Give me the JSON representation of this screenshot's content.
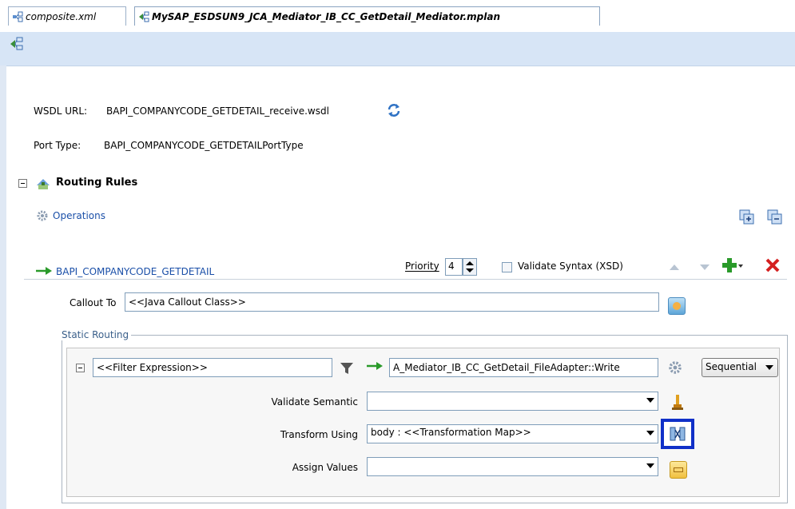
{
  "tabs": [
    {
      "label": "composite.xml"
    },
    {
      "label": "MySAP_ESDSUN9_JCA_Mediator_IB_CC_GetDetail_Mediator.mplan"
    }
  ],
  "wsdl": {
    "label": "WSDL URL:",
    "value": "BAPI_COMPANYCODE_GETDETAIL_receive.wsdl",
    "refresh_icon": "refresh-icon"
  },
  "port_type": {
    "label": "Port Type:",
    "value": "BAPI_COMPANYCODE_GETDETAILPortType"
  },
  "routing_rules": {
    "title": "Routing Rules",
    "operations_label": "Operations"
  },
  "operation": {
    "name": "BAPI_COMPANYCODE_GETDETAIL",
    "priority_label": "Priority",
    "priority_value": "4",
    "validate_syntax_label": "Validate Syntax (XSD)",
    "callout_label": "Callout To",
    "callout_value": "<<Java Callout Class>>"
  },
  "static_routing": {
    "legend": "Static Routing",
    "filter_value": "<<Filter Expression>>",
    "target_value": "A_Mediator_IB_CC_GetDetail_FileAdapter::Write",
    "mode_value": "Sequential",
    "validate_semantic_label": "Validate Semantic",
    "validate_semantic_value": "",
    "transform_label": "Transform Using",
    "transform_value": "body : <<Transformation Map>>",
    "assign_label": "Assign Values",
    "assign_value": ""
  },
  "colors": {
    "toolbar_bg": "#d7e5f6",
    "link": "#1a4fa8",
    "highlight_border": "#1030c8",
    "delete_red": "#d42020",
    "add_green": "#2a9a2a"
  }
}
